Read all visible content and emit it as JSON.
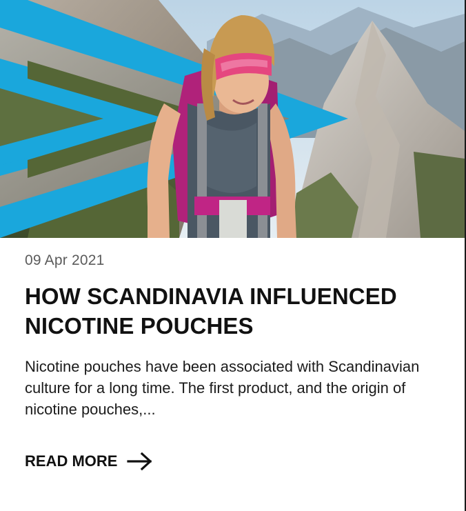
{
  "article": {
    "image": {
      "subject": "hiker-in-mountains-photo",
      "accent_shape": "chevron-graphic"
    },
    "date": "09 Apr 2021",
    "title": "HOW SCANDINAVIA INFLUENCED NICOTINE POUCHES",
    "excerpt": "Nicotine pouches have been associated with Scandinavian culture for a long time. The first product, and the origin of nicotine pouches,...",
    "read_more_label": "READ MORE"
  },
  "colors": {
    "accent_blue": "#1aa7dc",
    "text_dark": "#111111",
    "text_muted": "#5b5b5b",
    "background": "#ffffff"
  }
}
